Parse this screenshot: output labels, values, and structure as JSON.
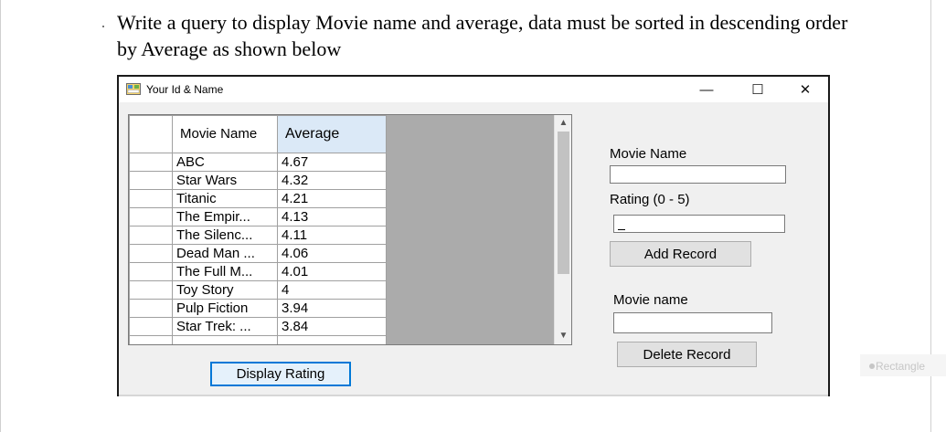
{
  "instruction_text": "Write a query to display Movie name and average, data must be sorted in descending order by Average as shown below",
  "window": {
    "title": "Your Id  & Name",
    "minimize_symbol": "—",
    "maximize_symbol": "☐",
    "close_symbol": "✕"
  },
  "grid": {
    "headers": {
      "name": "Movie Name",
      "average": "Average"
    },
    "rows": [
      {
        "name": "ABC",
        "average": "4.67"
      },
      {
        "name": "Star Wars",
        "average": "4.32"
      },
      {
        "name": "Titanic",
        "average": "4.21"
      },
      {
        "name": "The Empir...",
        "average": "4.13"
      },
      {
        "name": "The Silenc...",
        "average": "4.11"
      },
      {
        "name": "Dead Man ...",
        "average": "4.06"
      },
      {
        "name": "The Full M...",
        "average": "4.01"
      },
      {
        "name": "Toy Story",
        "average": "4"
      },
      {
        "name": "Pulp Fiction",
        "average": "3.94"
      },
      {
        "name": "Star Trek: ...",
        "average": "3.84"
      }
    ],
    "scroll_up_symbol": "▲",
    "scroll_down_symbol": "▼"
  },
  "form": {
    "movie_name_label": "Movie Name",
    "rating_label": "Rating (0 - 5)",
    "add_button": "Add Record",
    "delete_movie_label": "Movie name",
    "delete_button": "Delete Record",
    "display_button": "Display Rating"
  },
  "overlay": {
    "label": "Rectangle"
  },
  "colors": {
    "header_highlight": "#dbe9f7",
    "focus_border": "#0078d7",
    "grid_background": "#ababab"
  },
  "icons": {
    "app": "form-app-icon"
  }
}
